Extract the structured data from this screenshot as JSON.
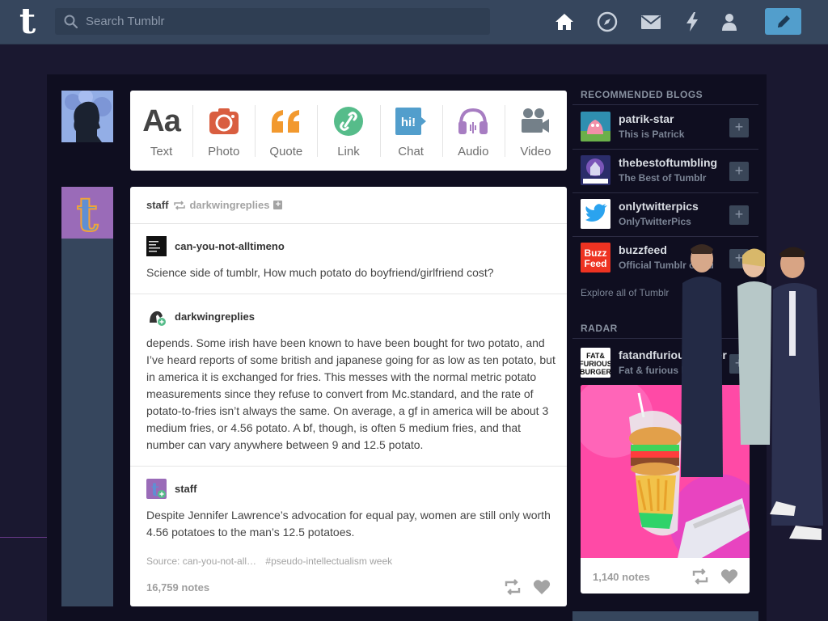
{
  "search": {
    "placeholder": "Search Tumblr"
  },
  "nav": {
    "home_icon": "home-icon",
    "explore_icon": "compass-icon",
    "messages_icon": "mail-icon",
    "activity_icon": "lightning-icon",
    "account_icon": "person-icon",
    "compose_icon": "pencil-icon"
  },
  "colors": {
    "accent": "#529ecc",
    "navbar": "#36465d",
    "background": "#1a1830"
  },
  "post_types": [
    {
      "label": "Text",
      "icon": "text-icon",
      "color": "#444444"
    },
    {
      "label": "Photo",
      "icon": "camera-icon",
      "color": "#d95e40"
    },
    {
      "label": "Quote",
      "icon": "quote-icon",
      "color": "#f2992e"
    },
    {
      "label": "Link",
      "icon": "link-icon",
      "color": "#56bc8a"
    },
    {
      "label": "Chat",
      "icon": "chat-icon",
      "color": "#529ecc"
    },
    {
      "label": "Audio",
      "icon": "headphones-icon",
      "color": "#a77dc2"
    },
    {
      "label": "Video",
      "icon": "video-icon",
      "color": "#748089"
    }
  ],
  "post": {
    "author": "staff",
    "reblogged_from": "darkwingreplies",
    "blocks": [
      {
        "user": "can-you-not-alltimeno",
        "text": "Science side of tumblr, How much potato do boyfriend/girlfriend cost?"
      },
      {
        "user": "darkwingreplies",
        "text": "depends. Some irish have been known to have been bought for two potato, and I’ve heard reports of some british and japanese going for as low as ten potato, but in america it is exchanged for fries. This messes with the normal metric potato measurements since they refuse to convert from Mc.standard, and the rate of potato-to-fries isn’t always the same. On average, a gf in america will be about 3 medium fries, or 4.56 potato. A bf, though, is often 5 medium fries, and that number can vary anywhere between 9 and 12.5 potato."
      },
      {
        "user": "staff",
        "text": "Despite Jennifer Lawrence’s advocation for equal pay, women are still only worth 4.56 potatoes to the man’s 12.5 potatoes."
      }
    ],
    "source": "Source: can-you-not-all…",
    "tag": "#pseudo-intellectualism week",
    "notes": "16,759 notes"
  },
  "recommended": {
    "heading": "RECOMMENDED BLOGS",
    "blogs": [
      {
        "name": "patrik-star",
        "title": "This is Patrick"
      },
      {
        "name": "thebestoftumbling",
        "title": "The Best of Tumblr"
      },
      {
        "name": "onlytwitterpics",
        "title": "OnlyTwitterPics"
      },
      {
        "name": "buzzfeed",
        "title": "Official Tumblr of Bu"
      }
    ],
    "explore": "Explore all of Tumblr"
  },
  "radar": {
    "heading": "RADAR",
    "blog": "fatandfuriousburger",
    "title": "Fat & furious burger.",
    "notes": "1,140 notes"
  }
}
